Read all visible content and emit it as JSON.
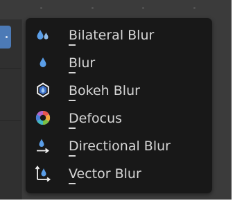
{
  "menu": {
    "items": [
      {
        "label": "Bilateral Blur",
        "icon": "bilateral-blur-icon"
      },
      {
        "label": "Blur",
        "icon": "blur-icon"
      },
      {
        "label": "Bokeh Blur",
        "icon": "bokeh-blur-icon"
      },
      {
        "label": "Defocus",
        "icon": "defocus-icon"
      },
      {
        "label": "Directional Blur",
        "icon": "directional-blur-icon"
      },
      {
        "label": "Vector Blur",
        "icon": "vector-blur-icon"
      }
    ]
  },
  "colors": {
    "background": "#3b3b3b",
    "menu_background": "#181818",
    "text": "#d6d6d6",
    "icon_blue": "#5a9ee8",
    "accent_handle": "#4c7ab6"
  }
}
